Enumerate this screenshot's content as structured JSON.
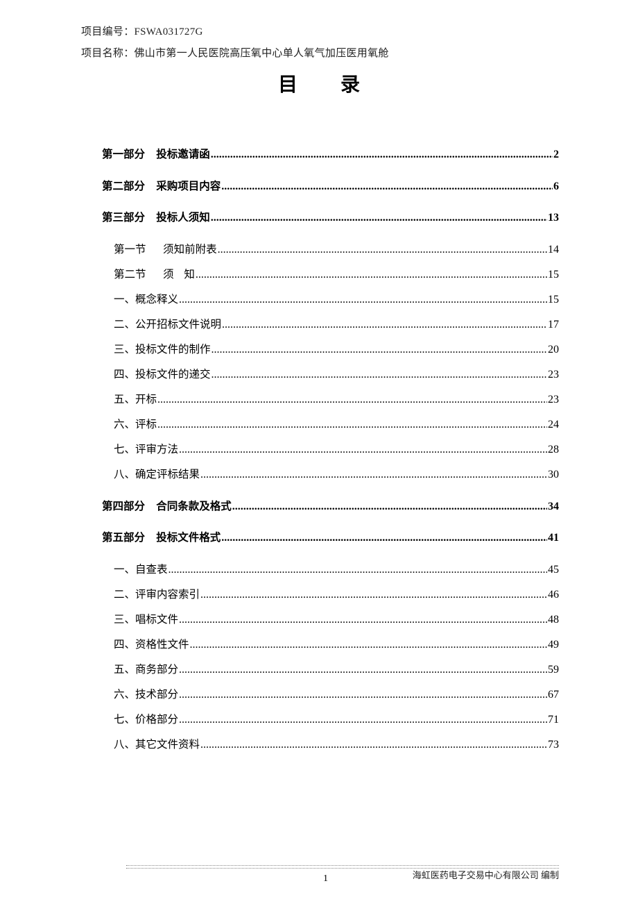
{
  "header": {
    "project_number_label": "项目编号：FSWA031727G",
    "project_name_label": "项目名称：佛山市第一人民医院高压氧中心单人氧气加压医用氧舱"
  },
  "title": {
    "char1": "目",
    "char2": "录"
  },
  "toc": [
    {
      "level": "part",
      "label": "第一部分   投标邀请函",
      "page": "2"
    },
    {
      "level": "part",
      "label": "第二部分   采购项目内容",
      "page": "6"
    },
    {
      "level": "part",
      "label": "第三部分   投标人须知",
      "page": "13"
    },
    {
      "level": "sub",
      "label": "第一节     须知前附表",
      "page": "14"
    },
    {
      "level": "sub",
      "label": "第二节     须   知",
      "page": "15"
    },
    {
      "level": "sub",
      "label": "一、概念释义",
      "page": "15"
    },
    {
      "level": "sub",
      "label": "二、公开招标文件说明",
      "page": "17"
    },
    {
      "level": "sub",
      "label": "三、投标文件的制作",
      "page": "20"
    },
    {
      "level": "sub",
      "label": "四、投标文件的递交",
      "page": "23"
    },
    {
      "level": "sub",
      "label": "五、开标",
      "page": "23"
    },
    {
      "level": "sub",
      "label": "六、评标",
      "page": "24"
    },
    {
      "level": "sub",
      "label": "七、评审方法",
      "page": "28"
    },
    {
      "level": "sub",
      "label": "八、确定评标结果",
      "page": "30"
    },
    {
      "level": "part",
      "label": "第四部分   合同条款及格式",
      "page": "34"
    },
    {
      "level": "part",
      "label": "第五部分   投标文件格式",
      "page": "41"
    },
    {
      "level": "sub",
      "label": "一、自查表",
      "page": "45"
    },
    {
      "level": "sub",
      "label": "二、评审内容索引",
      "page": "46"
    },
    {
      "level": "sub",
      "label": "三、唱标文件",
      "page": "48"
    },
    {
      "level": "sub",
      "label": "四、资格性文件",
      "page": "49"
    },
    {
      "level": "sub",
      "label": "五、商务部分",
      "page": "59"
    },
    {
      "level": "sub",
      "label": "六、技术部分",
      "page": "67"
    },
    {
      "level": "sub",
      "label": "七、价格部分",
      "page": "71"
    },
    {
      "level": "sub",
      "label": "八、其它文件资料",
      "page": "73"
    }
  ],
  "footer": {
    "page_number": "1",
    "organization": "海虹医药电子交易中心有限公司    编制"
  }
}
